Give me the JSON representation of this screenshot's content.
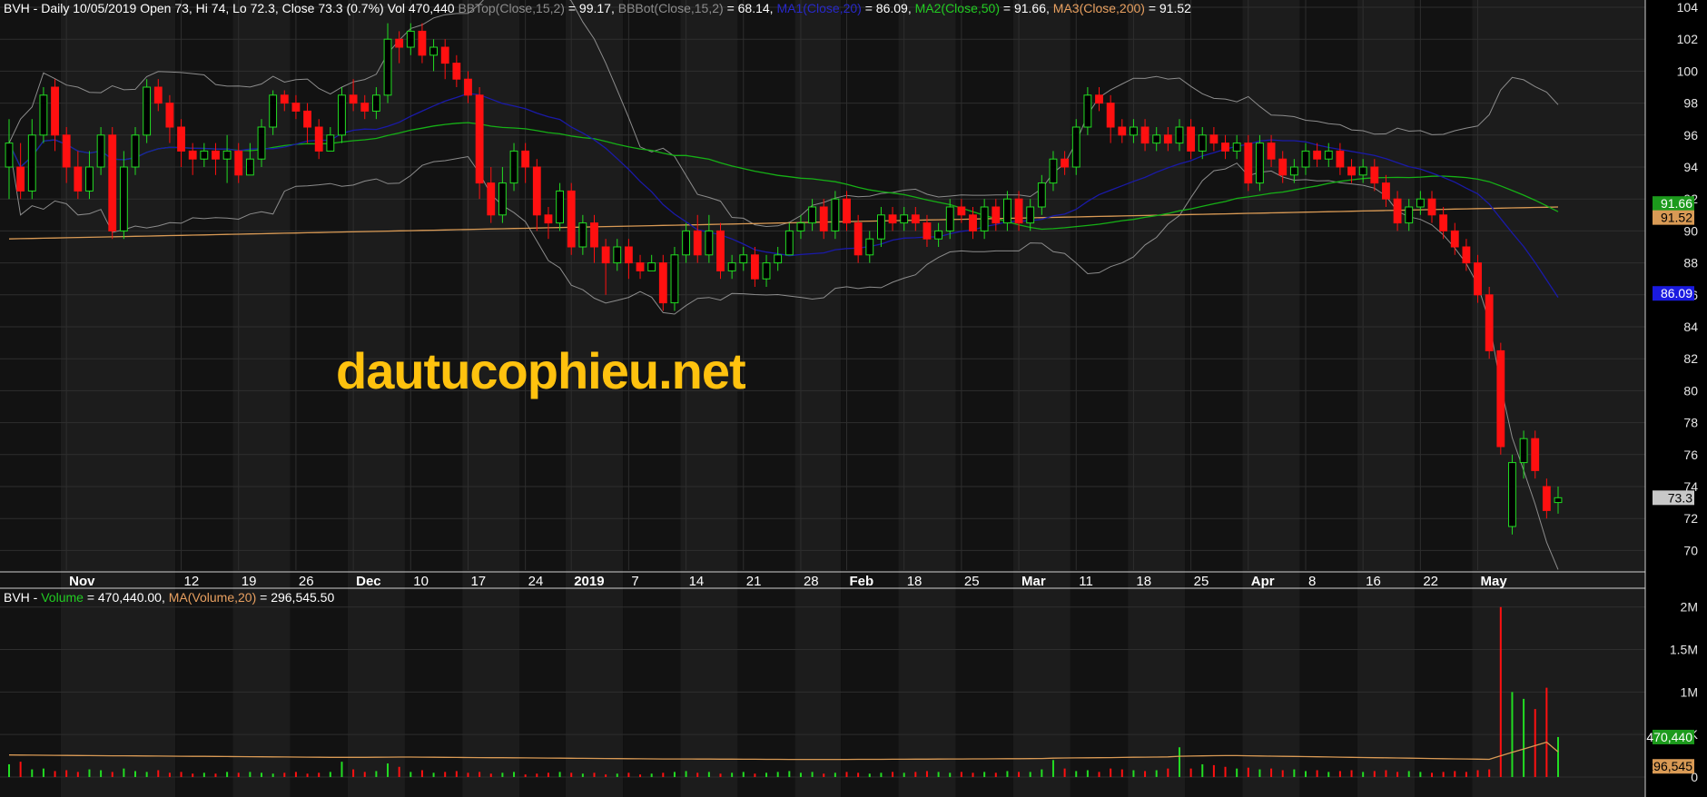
{
  "header_price": {
    "title": "BVH - Daily 10/05/2019 Open 73, Hi 74, Lo 72.3, Close 73.3 (0.7%) Vol 470,440",
    "bbtop": "BBTop(Close,15,2)",
    "bbtop_val": " = 99.17,",
    "bbbot": "BBBot(Close,15,2)",
    "bbbot_val": " = 68.14,",
    "ma1": "MA1(Close,20)",
    "ma1_val": " = 86.09,",
    "ma2": "MA2(Close,50)",
    "ma2_val": " = 91.66,",
    "ma3": "MA3(Close,200)",
    "ma3_val": " = 91.52"
  },
  "header_volume": {
    "prefix": "BVH - ",
    "vol": "Volume",
    "vol_val": " = 470,440.00,",
    "ma": "MA(Volume,20)",
    "ma_val": " = 296,545.50"
  },
  "watermark": "dautucophieu.net",
  "colors": {
    "background": "#000000",
    "up": "#22dd22",
    "down": "#ff1010",
    "bb": "#8c8c8c",
    "ma1": "#1a1aa8",
    "ma2": "#16b016",
    "ma3": "#d99a55",
    "watermark": "#ffc20e",
    "grid": "#2e2e2e"
  },
  "chart_data": {
    "type": "candlestick",
    "price_axis": {
      "range": [
        69,
        104
      ],
      "ticks": [
        70,
        72,
        74,
        76,
        78,
        80,
        82,
        84,
        86,
        88,
        90,
        92,
        94,
        96,
        98,
        100,
        102,
        104
      ]
    },
    "volume_axis": {
      "range": [
        0,
        2200000
      ],
      "ticks": [
        {
          "v": 0,
          "l": "0"
        },
        {
          "v": 500000,
          "l": "500K"
        },
        {
          "v": 1000000,
          "l": "1M"
        },
        {
          "v": 1500000,
          "l": "1.5M"
        },
        {
          "v": 2000000,
          "l": "2M"
        }
      ]
    },
    "x_labels": [
      {
        "i": 5,
        "l": "Nov",
        "b": true
      },
      {
        "i": 15,
        "l": "12"
      },
      {
        "i": 20,
        "l": "19"
      },
      {
        "i": 25,
        "l": "26"
      },
      {
        "i": 30,
        "l": "Dec",
        "b": true
      },
      {
        "i": 35,
        "l": "10"
      },
      {
        "i": 40,
        "l": "17"
      },
      {
        "i": 45,
        "l": "24"
      },
      {
        "i": 49,
        "l": "2019",
        "b": true
      },
      {
        "i": 54,
        "l": "7"
      },
      {
        "i": 59,
        "l": "14"
      },
      {
        "i": 64,
        "l": "21"
      },
      {
        "i": 69,
        "l": "28"
      },
      {
        "i": 73,
        "l": "Feb",
        "b": true
      },
      {
        "i": 78,
        "l": "18"
      },
      {
        "i": 83,
        "l": "25"
      },
      {
        "i": 88,
        "l": "Mar",
        "b": true
      },
      {
        "i": 93,
        "l": "11"
      },
      {
        "i": 98,
        "l": "18"
      },
      {
        "i": 103,
        "l": "25"
      },
      {
        "i": 108,
        "l": "Apr",
        "b": true
      },
      {
        "i": 113,
        "l": "8"
      },
      {
        "i": 118,
        "l": "16"
      },
      {
        "i": 123,
        "l": "22"
      },
      {
        "i": 128,
        "l": "May",
        "b": true
      }
    ],
    "candles": [
      [
        94,
        95.5,
        92,
        97
      ],
      [
        94,
        92.5,
        92,
        95.5
      ],
      [
        92.5,
        96,
        92,
        97
      ],
      [
        96,
        98.5,
        95.5,
        99
      ],
      [
        99,
        96,
        95,
        99.5
      ],
      [
        96,
        94,
        93,
        96.5
      ],
      [
        94,
        92.5,
        92,
        95
      ],
      [
        92.5,
        94,
        92,
        95
      ],
      [
        94,
        96,
        93.5,
        96.5
      ],
      [
        96,
        90,
        89.5,
        96.5
      ],
      [
        90,
        94,
        89.5,
        95
      ],
      [
        94,
        96,
        93.5,
        96.5
      ],
      [
        96,
        99,
        95.5,
        99.5
      ],
      [
        99,
        98,
        97.5,
        99.5
      ],
      [
        98,
        96.5,
        95.5,
        98.5
      ],
      [
        96.5,
        95,
        94,
        97
      ],
      [
        95,
        94.5,
        93.5,
        95.5
      ],
      [
        94.5,
        95,
        94,
        95.5
      ],
      [
        95,
        94.5,
        93.5,
        95.5
      ],
      [
        94.5,
        95,
        93,
        96
      ],
      [
        95,
        93.5,
        93,
        95.5
      ],
      [
        93.5,
        94.5,
        93.5,
        95.5
      ],
      [
        94.5,
        96.5,
        94,
        97
      ],
      [
        96.5,
        98.5,
        96,
        98.8
      ],
      [
        98.5,
        98,
        97.5,
        98.8
      ],
      [
        98,
        97.5,
        97,
        98.5
      ],
      [
        97.5,
        96.5,
        95.5,
        98
      ],
      [
        96.5,
        95,
        94.5,
        97
      ],
      [
        95,
        96,
        95,
        96.5
      ],
      [
        96,
        98.5,
        95.5,
        99
      ],
      [
        98.5,
        98,
        97.5,
        99.5
      ],
      [
        98,
        97.5,
        97,
        98.5
      ],
      [
        97.5,
        98.5,
        97,
        99
      ],
      [
        98.5,
        102,
        98,
        103
      ],
      [
        102,
        101.5,
        100.5,
        102.5
      ],
      [
        101.5,
        102.5,
        101,
        103
      ],
      [
        102.5,
        101,
        100.5,
        103
      ],
      [
        101,
        101.5,
        100,
        102
      ],
      [
        101.5,
        100.5,
        99.5,
        102
      ],
      [
        100.5,
        99.5,
        99,
        101
      ],
      [
        99.5,
        98.5,
        98,
        100
      ],
      [
        98.5,
        93,
        92,
        99
      ],
      [
        93,
        91,
        90.5,
        94
      ],
      [
        91,
        93,
        90.5,
        94
      ],
      [
        93,
        95,
        92.5,
        95.5
      ],
      [
        95,
        94,
        93,
        95.5
      ],
      [
        94,
        91,
        90,
        94.5
      ],
      [
        91,
        90.5,
        89.5,
        91.5
      ],
      [
        90.5,
        92.5,
        90,
        93
      ],
      [
        92.5,
        89,
        88.5,
        93
      ],
      [
        89,
        90.5,
        88.5,
        91
      ],
      [
        90.5,
        89,
        88,
        91
      ],
      [
        89,
        88,
        86,
        89.5
      ],
      [
        88,
        89,
        87.5,
        89.5
      ],
      [
        89,
        88,
        87,
        89.5
      ],
      [
        88,
        87.5,
        87,
        88.5
      ],
      [
        87.5,
        88,
        87.5,
        88.5
      ],
      [
        88,
        85.5,
        85,
        88.5
      ],
      [
        85.5,
        88.5,
        85,
        89
      ],
      [
        88.5,
        90,
        88,
        90.5
      ],
      [
        90,
        88.5,
        88,
        91
      ],
      [
        88.5,
        90,
        88,
        91
      ],
      [
        90,
        87.5,
        87,
        90.5
      ],
      [
        87.5,
        88,
        87,
        88.5
      ],
      [
        88,
        88.5,
        87.5,
        89
      ],
      [
        88.5,
        87,
        86.5,
        89
      ],
      [
        87,
        88,
        86.5,
        88.5
      ],
      [
        88,
        88.5,
        87.5,
        89
      ],
      [
        88.5,
        90,
        88.5,
        90.5
      ],
      [
        90,
        90.5,
        89.5,
        91
      ],
      [
        90.5,
        91.5,
        90,
        92
      ],
      [
        91.5,
        90,
        89.5,
        92
      ],
      [
        90,
        92,
        89.5,
        92.5
      ],
      [
        92,
        90.5,
        90,
        92.5
      ],
      [
        90.5,
        88.5,
        88,
        91
      ],
      [
        88.5,
        89.5,
        88,
        90
      ],
      [
        89.5,
        91,
        89,
        91.5
      ],
      [
        91,
        90.5,
        90,
        91.5
      ],
      [
        90.5,
        91,
        90,
        91.5
      ],
      [
        91,
        90.5,
        90,
        91.5
      ],
      [
        90.5,
        89.5,
        89,
        91
      ],
      [
        89.5,
        90,
        89,
        90.5
      ],
      [
        90,
        91.5,
        89.5,
        92
      ],
      [
        91.5,
        91,
        90.5,
        92
      ],
      [
        91,
        90,
        89.5,
        91.5
      ],
      [
        90,
        91.5,
        89.5,
        92
      ],
      [
        91.5,
        90.5,
        90,
        92
      ],
      [
        90.5,
        92,
        90,
        92.5
      ],
      [
        92,
        90.5,
        90,
        92.5
      ],
      [
        90.5,
        91.5,
        90,
        92
      ],
      [
        91.5,
        93,
        91,
        93.5
      ],
      [
        93,
        94.5,
        92.5,
        95
      ],
      [
        94.5,
        94,
        93.5,
        95
      ],
      [
        94,
        96.5,
        93.5,
        97
      ],
      [
        96.5,
        98.5,
        96,
        99
      ],
      [
        98.5,
        98,
        97.5,
        99
      ],
      [
        98,
        96.5,
        95.5,
        98.5
      ],
      [
        96.5,
        96,
        95.5,
        97
      ],
      [
        96,
        96.5,
        95.5,
        97
      ],
      [
        96.5,
        95.5,
        95,
        97
      ],
      [
        95.5,
        96,
        95,
        96.5
      ],
      [
        96,
        95.5,
        95,
        96.5
      ],
      [
        95.5,
        96.5,
        95,
        97
      ],
      [
        96.5,
        95,
        94.5,
        97
      ],
      [
        95,
        96,
        94.5,
        96.5
      ],
      [
        96,
        95.5,
        95,
        96.5
      ],
      [
        95.5,
        95,
        94.5,
        96
      ],
      [
        95,
        95.5,
        94.5,
        96
      ],
      [
        95.5,
        93,
        92.5,
        96
      ],
      [
        93,
        95.5,
        92.5,
        96
      ],
      [
        95.5,
        94.5,
        94,
        96
      ],
      [
        94.5,
        93.5,
        93,
        95
      ],
      [
        93.5,
        94,
        93,
        94.5
      ],
      [
        94,
        95,
        93.5,
        95.5
      ],
      [
        95,
        94.5,
        94,
        95.5
      ],
      [
        94.5,
        95,
        94,
        95.5
      ],
      [
        95,
        94,
        93.5,
        95.5
      ],
      [
        94,
        93.5,
        93,
        94.5
      ],
      [
        93.5,
        94,
        93,
        94.5
      ],
      [
        94,
        93,
        92.5,
        94.5
      ],
      [
        93,
        92,
        91.5,
        93.5
      ],
      [
        92,
        90.5,
        90,
        92.5
      ],
      [
        90.5,
        91.5,
        90,
        92
      ],
      [
        91.5,
        92,
        91,
        92.5
      ],
      [
        92,
        91,
        90.5,
        92.5
      ],
      [
        91,
        90,
        89.5,
        91.5
      ],
      [
        90,
        89,
        88.5,
        90.5
      ],
      [
        89,
        88,
        87.5,
        89.5
      ],
      [
        88,
        86,
        85.5,
        88.5
      ],
      [
        86,
        82.5,
        82,
        86.5
      ],
      [
        82.5,
        76.5,
        76,
        83
      ],
      [
        71.5,
        75.5,
        71,
        76
      ],
      [
        75.5,
        77,
        74.5,
        77.5
      ],
      [
        77,
        75,
        74.5,
        77.5
      ],
      [
        74,
        72.5,
        72,
        74.5
      ],
      [
        73,
        73.3,
        72.3,
        74
      ]
    ],
    "volume": [
      150000,
      180000,
      90000,
      100000,
      70000,
      80000,
      60000,
      90000,
      80000,
      60000,
      100000,
      70000,
      60000,
      80000,
      50000,
      60000,
      40000,
      50000,
      40000,
      60000,
      50000,
      60000,
      50000,
      40000,
      50000,
      60000,
      40000,
      50000,
      60000,
      180000,
      90000,
      60000,
      70000,
      160000,
      120000,
      60000,
      80000,
      50000,
      60000,
      70000,
      50000,
      60000,
      40000,
      50000,
      60000,
      30000,
      40000,
      50000,
      60000,
      50000,
      40000,
      50000,
      30000,
      40000,
      50000,
      30000,
      40000,
      50000,
      60000,
      70000,
      50000,
      60000,
      40000,
      50000,
      60000,
      40000,
      50000,
      60000,
      70000,
      50000,
      60000,
      40000,
      50000,
      60000,
      50000,
      40000,
      50000,
      60000,
      50000,
      60000,
      70000,
      60000,
      50000,
      60000,
      50000,
      60000,
      50000,
      70000,
      60000,
      60000,
      90000,
      200000,
      100000,
      70000,
      80000,
      60000,
      100000,
      90000,
      80000,
      70000,
      80000,
      100000,
      350000,
      100000,
      150000,
      140000,
      120000,
      100000,
      110000,
      90000,
      100000,
      80000,
      90000,
      70000,
      80000,
      60000,
      70000,
      80000,
      60000,
      70000,
      80000,
      60000,
      70000,
      60000,
      50000,
      60000,
      70000,
      60000,
      80000,
      90000,
      2000000,
      1000000,
      920000,
      800000,
      1050000,
      470440
    ],
    "vol_ma": [
      260000,
      258000,
      257000,
      256000,
      255000,
      254000,
      253000,
      252000,
      251000,
      250000,
      250000,
      249000,
      248000,
      247000,
      246000,
      245000,
      244000,
      243000,
      242000,
      241000,
      240000,
      239000,
      238000,
      237000,
      236000,
      235000,
      234000,
      233000,
      232000,
      232000,
      232000,
      232000,
      233000,
      234000,
      235000,
      235000,
      234000,
      233000,
      232000,
      231000,
      230000,
      229000,
      228000,
      227000,
      226000,
      225000,
      224000,
      223000,
      222000,
      221000,
      220000,
      219000,
      218000,
      217000,
      216000,
      215000,
      214000,
      213000,
      212000,
      212000,
      211000,
      211000,
      210000,
      210000,
      209000,
      209000,
      208000,
      208000,
      207000,
      207000,
      207000,
      207000,
      207000,
      207000,
      208000,
      208000,
      208000,
      209000,
      209000,
      210000,
      210000,
      211000,
      212000,
      213000,
      214000,
      214000,
      215000,
      216000,
      216000,
      217000,
      218000,
      222000,
      224000,
      225000,
      226000,
      227000,
      229000,
      231000,
      233000,
      234000,
      235000,
      237000,
      245000,
      247000,
      249000,
      251000,
      252000,
      252000,
      250000,
      248000,
      246000,
      244000,
      242000,
      240000,
      238000,
      236000,
      234000,
      232000,
      230000,
      228000,
      226000,
      224000,
      222000,
      220000,
      218000,
      216000,
      214000,
      212000,
      210000,
      208000,
      250000,
      290000,
      330000,
      370000,
      410000,
      296545
    ]
  }
}
